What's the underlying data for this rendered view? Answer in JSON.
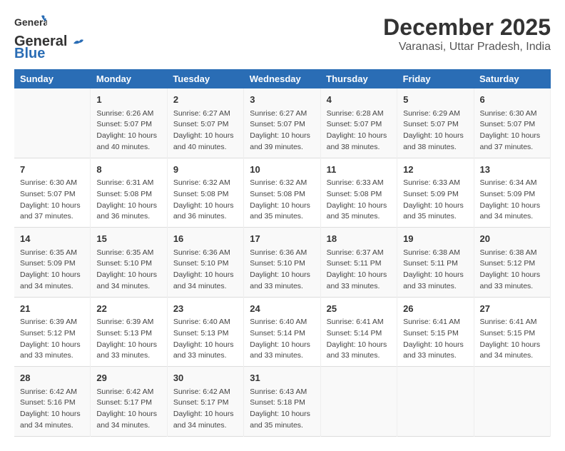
{
  "header": {
    "logo_line1": "General",
    "logo_line2": "Blue",
    "month": "December 2025",
    "location": "Varanasi, Uttar Pradesh, India"
  },
  "weekdays": [
    "Sunday",
    "Monday",
    "Tuesday",
    "Wednesday",
    "Thursday",
    "Friday",
    "Saturday"
  ],
  "weeks": [
    [
      {
        "day": "",
        "content": ""
      },
      {
        "day": "1",
        "content": "Sunrise: 6:26 AM\nSunset: 5:07 PM\nDaylight: 10 hours\nand 40 minutes."
      },
      {
        "day": "2",
        "content": "Sunrise: 6:27 AM\nSunset: 5:07 PM\nDaylight: 10 hours\nand 40 minutes."
      },
      {
        "day": "3",
        "content": "Sunrise: 6:27 AM\nSunset: 5:07 PM\nDaylight: 10 hours\nand 39 minutes."
      },
      {
        "day": "4",
        "content": "Sunrise: 6:28 AM\nSunset: 5:07 PM\nDaylight: 10 hours\nand 38 minutes."
      },
      {
        "day": "5",
        "content": "Sunrise: 6:29 AM\nSunset: 5:07 PM\nDaylight: 10 hours\nand 38 minutes."
      },
      {
        "day": "6",
        "content": "Sunrise: 6:30 AM\nSunset: 5:07 PM\nDaylight: 10 hours\nand 37 minutes."
      }
    ],
    [
      {
        "day": "7",
        "content": "Sunrise: 6:30 AM\nSunset: 5:07 PM\nDaylight: 10 hours\nand 37 minutes."
      },
      {
        "day": "8",
        "content": "Sunrise: 6:31 AM\nSunset: 5:08 PM\nDaylight: 10 hours\nand 36 minutes."
      },
      {
        "day": "9",
        "content": "Sunrise: 6:32 AM\nSunset: 5:08 PM\nDaylight: 10 hours\nand 36 minutes."
      },
      {
        "day": "10",
        "content": "Sunrise: 6:32 AM\nSunset: 5:08 PM\nDaylight: 10 hours\nand 35 minutes."
      },
      {
        "day": "11",
        "content": "Sunrise: 6:33 AM\nSunset: 5:08 PM\nDaylight: 10 hours\nand 35 minutes."
      },
      {
        "day": "12",
        "content": "Sunrise: 6:33 AM\nSunset: 5:09 PM\nDaylight: 10 hours\nand 35 minutes."
      },
      {
        "day": "13",
        "content": "Sunrise: 6:34 AM\nSunset: 5:09 PM\nDaylight: 10 hours\nand 34 minutes."
      }
    ],
    [
      {
        "day": "14",
        "content": "Sunrise: 6:35 AM\nSunset: 5:09 PM\nDaylight: 10 hours\nand 34 minutes."
      },
      {
        "day": "15",
        "content": "Sunrise: 6:35 AM\nSunset: 5:10 PM\nDaylight: 10 hours\nand 34 minutes."
      },
      {
        "day": "16",
        "content": "Sunrise: 6:36 AM\nSunset: 5:10 PM\nDaylight: 10 hours\nand 34 minutes."
      },
      {
        "day": "17",
        "content": "Sunrise: 6:36 AM\nSunset: 5:10 PM\nDaylight: 10 hours\nand 33 minutes."
      },
      {
        "day": "18",
        "content": "Sunrise: 6:37 AM\nSunset: 5:11 PM\nDaylight: 10 hours\nand 33 minutes."
      },
      {
        "day": "19",
        "content": "Sunrise: 6:38 AM\nSunset: 5:11 PM\nDaylight: 10 hours\nand 33 minutes."
      },
      {
        "day": "20",
        "content": "Sunrise: 6:38 AM\nSunset: 5:12 PM\nDaylight: 10 hours\nand 33 minutes."
      }
    ],
    [
      {
        "day": "21",
        "content": "Sunrise: 6:39 AM\nSunset: 5:12 PM\nDaylight: 10 hours\nand 33 minutes."
      },
      {
        "day": "22",
        "content": "Sunrise: 6:39 AM\nSunset: 5:13 PM\nDaylight: 10 hours\nand 33 minutes."
      },
      {
        "day": "23",
        "content": "Sunrise: 6:40 AM\nSunset: 5:13 PM\nDaylight: 10 hours\nand 33 minutes."
      },
      {
        "day": "24",
        "content": "Sunrise: 6:40 AM\nSunset: 5:14 PM\nDaylight: 10 hours\nand 33 minutes."
      },
      {
        "day": "25",
        "content": "Sunrise: 6:41 AM\nSunset: 5:14 PM\nDaylight: 10 hours\nand 33 minutes."
      },
      {
        "day": "26",
        "content": "Sunrise: 6:41 AM\nSunset: 5:15 PM\nDaylight: 10 hours\nand 33 minutes."
      },
      {
        "day": "27",
        "content": "Sunrise: 6:41 AM\nSunset: 5:15 PM\nDaylight: 10 hours\nand 34 minutes."
      }
    ],
    [
      {
        "day": "28",
        "content": "Sunrise: 6:42 AM\nSunset: 5:16 PM\nDaylight: 10 hours\nand 34 minutes."
      },
      {
        "day": "29",
        "content": "Sunrise: 6:42 AM\nSunset: 5:17 PM\nDaylight: 10 hours\nand 34 minutes."
      },
      {
        "day": "30",
        "content": "Sunrise: 6:42 AM\nSunset: 5:17 PM\nDaylight: 10 hours\nand 34 minutes."
      },
      {
        "day": "31",
        "content": "Sunrise: 6:43 AM\nSunset: 5:18 PM\nDaylight: 10 hours\nand 35 minutes."
      },
      {
        "day": "",
        "content": ""
      },
      {
        "day": "",
        "content": ""
      },
      {
        "day": "",
        "content": ""
      }
    ]
  ]
}
